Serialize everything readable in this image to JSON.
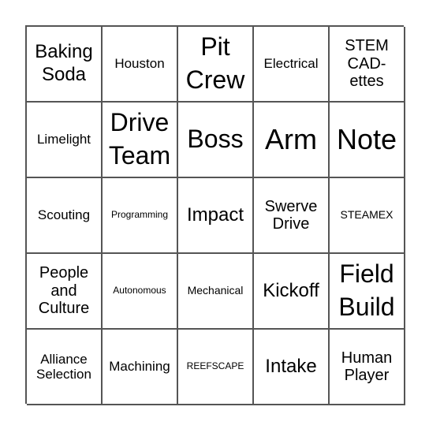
{
  "board": {
    "cells": [
      {
        "label": "Baking Soda",
        "size": "s-xl"
      },
      {
        "label": "Houston",
        "size": "s-m"
      },
      {
        "label": "Pit Crew",
        "size": "s-xxl"
      },
      {
        "label": "Electrical",
        "size": "s-m"
      },
      {
        "label": "STEM CAD- ettes",
        "size": "s-l"
      },
      {
        "label": "Limelight",
        "size": "s-m"
      },
      {
        "label": "Drive Team",
        "size": "s-xxl"
      },
      {
        "label": "Boss",
        "size": "s-xxl"
      },
      {
        "label": "Arm",
        "size": "s-xxxl"
      },
      {
        "label": "Note",
        "size": "s-xxxl"
      },
      {
        "label": "Scouting",
        "size": "s-m"
      },
      {
        "label": "Programming",
        "size": "s-xs"
      },
      {
        "label": "Impact",
        "size": "s-xl"
      },
      {
        "label": "Swerve Drive",
        "size": "s-l"
      },
      {
        "label": "STEAMEX",
        "size": "s-s"
      },
      {
        "label": "People and Culture",
        "size": "s-l"
      },
      {
        "label": "Autonomous",
        "size": "s-xs"
      },
      {
        "label": "Mechanical",
        "size": "s-s"
      },
      {
        "label": "Kickoff",
        "size": "s-xl"
      },
      {
        "label": "Field Build",
        "size": "s-xxl"
      },
      {
        "label": "Alliance Selection",
        "size": "s-m"
      },
      {
        "label": "Machining",
        "size": "s-m"
      },
      {
        "label": "REEFSCAPE",
        "size": "s-xs"
      },
      {
        "label": "Intake",
        "size": "s-xl"
      },
      {
        "label": "Human Player",
        "size": "s-l"
      }
    ]
  }
}
